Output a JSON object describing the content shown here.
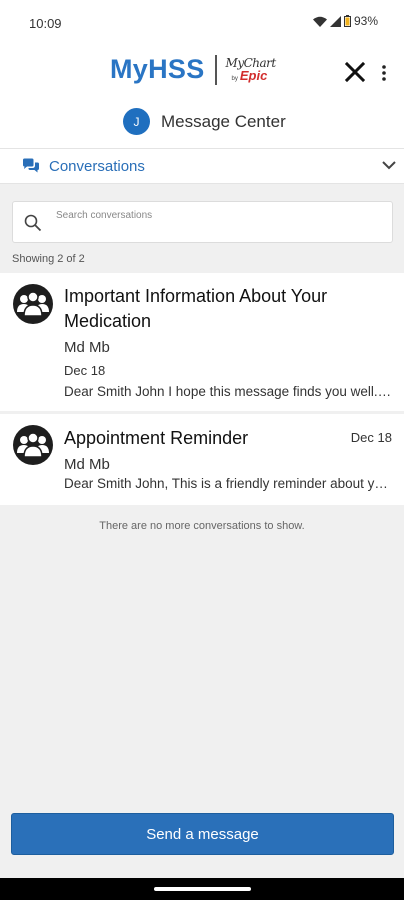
{
  "status_bar": {
    "time": "10:09",
    "battery": "93%"
  },
  "header": {
    "brand": "MyHSS",
    "partner_logo_text": "MyChart",
    "partner_by": "by",
    "partner_brand": "Epic",
    "close_icon": "close-icon",
    "more_icon": "more-vertical-icon"
  },
  "message_center": {
    "avatar_initial": "J",
    "title": "Message Center"
  },
  "conversations_bar": {
    "label": "Conversations",
    "icon": "chat-bubbles-icon",
    "chevron": "chevron-down-icon"
  },
  "search": {
    "placeholder": "Search conversations",
    "value": ""
  },
  "showing_text": "Showing 2 of 2",
  "conversations": [
    {
      "subject": "Important Information About Your Medication",
      "sender": "Md Mb",
      "date": "Dec 18",
      "preview": "Dear Smith John   I hope this message finds you well. I wanted to share some important information"
    },
    {
      "subject": "Appointment Reminder",
      "sender": "Md Mb",
      "date": "Dec 18",
      "preview": "Dear Smith John,   This is a friendly reminder about your upcoming appointment"
    }
  ],
  "no_more_text": "There are no more conversations to show.",
  "send_button_label": "Send a message",
  "colors": {
    "brand_blue": "#2a75c4",
    "button_blue": "#2a70b9",
    "epic_red": "#d22d2d",
    "avatar_blue": "#1f6fbf"
  }
}
